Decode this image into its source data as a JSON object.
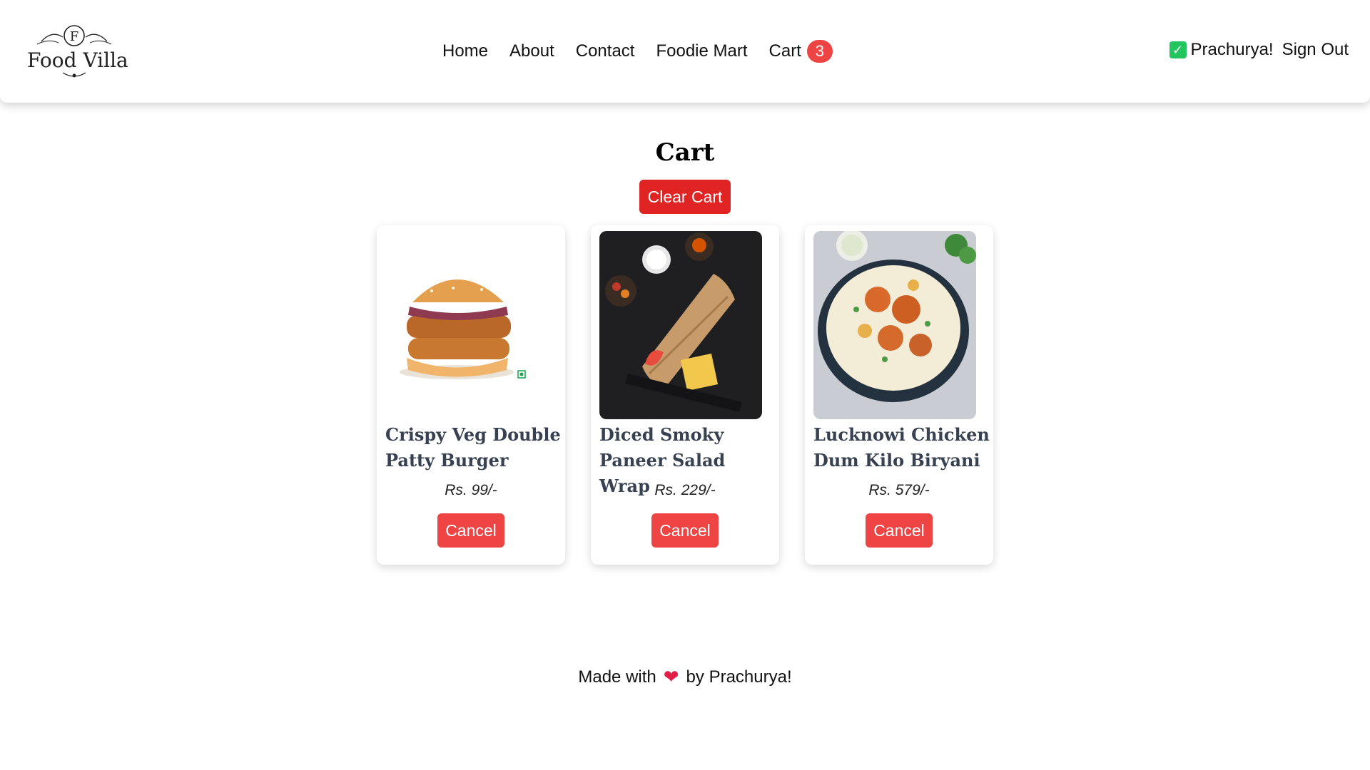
{
  "header": {
    "logo_letter": "F",
    "logo_text": "Food Villa",
    "nav": {
      "home": "Home",
      "about": "About",
      "contact": "Contact",
      "foodie_mart": "Foodie Mart",
      "cart": "Cart",
      "cart_count": "3"
    },
    "user_name": "Prachurya!",
    "sign_out": "Sign Out"
  },
  "main": {
    "title": "Cart",
    "clear_button": "Clear Cart",
    "items": [
      {
        "name": "Crispy Veg Double Patty Burger",
        "price": "Rs. 99/-",
        "cancel": "Cancel"
      },
      {
        "name": "Diced Smoky Paneer Salad Wrap",
        "price": "Rs. 229/-",
        "cancel": "Cancel"
      },
      {
        "name": "Lucknowi Chicken Dum Kilo Biryani",
        "price": "Rs. 579/-",
        "cancel": "Cancel"
      }
    ]
  },
  "footer": {
    "prefix": "Made with",
    "suffix": "by Prachurya!"
  },
  "colors": {
    "accent_red": "#ef4444",
    "clear_red": "#e02424",
    "check_green": "#22c55e"
  }
}
